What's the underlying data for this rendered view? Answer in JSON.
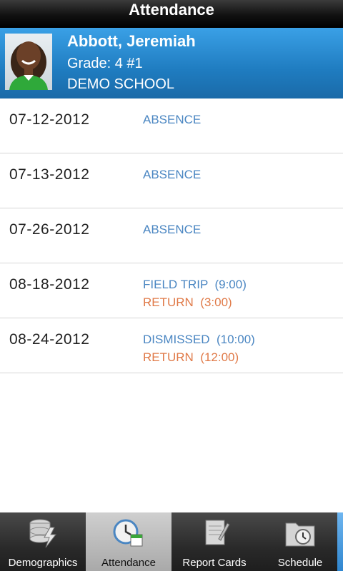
{
  "header": {
    "title": "Attendance"
  },
  "student": {
    "name": "Abbott, Jeremiah",
    "grade_line": "Grade: 4  #1",
    "school": "DEMO SCHOOL"
  },
  "records": [
    {
      "date": "07-12-2012",
      "events": [
        {
          "type": "primary",
          "text": "ABSENCE"
        }
      ]
    },
    {
      "date": "07-13-2012",
      "events": [
        {
          "type": "primary",
          "text": "ABSENCE"
        }
      ]
    },
    {
      "date": "07-26-2012",
      "events": [
        {
          "type": "primary",
          "text": "ABSENCE"
        }
      ]
    },
    {
      "date": "08-18-2012",
      "events": [
        {
          "type": "primary",
          "text": "FIELD TRIP  (9:00)"
        },
        {
          "type": "return",
          "text": "RETURN  (3:00)"
        }
      ]
    },
    {
      "date": "08-24-2012",
      "events": [
        {
          "type": "primary",
          "text": "DISMISSED  (10:00)"
        },
        {
          "type": "return",
          "text": "RETURN  (12:00)"
        }
      ]
    }
  ],
  "tabs": [
    {
      "label": "Demographics",
      "icon": "database-icon",
      "active": false
    },
    {
      "label": "Attendance",
      "icon": "clock-calendar-icon",
      "active": true
    },
    {
      "label": "Report Cards",
      "icon": "notebook-icon",
      "active": false
    },
    {
      "label": "Schedule",
      "icon": "folder-clock-icon",
      "active": false
    }
  ],
  "colors": {
    "header_bg": "#111111",
    "student_band": "#1f7cc0",
    "event_primary": "#4a86c2",
    "event_return": "#e07a48",
    "tab_active": "#bdbdbd"
  }
}
